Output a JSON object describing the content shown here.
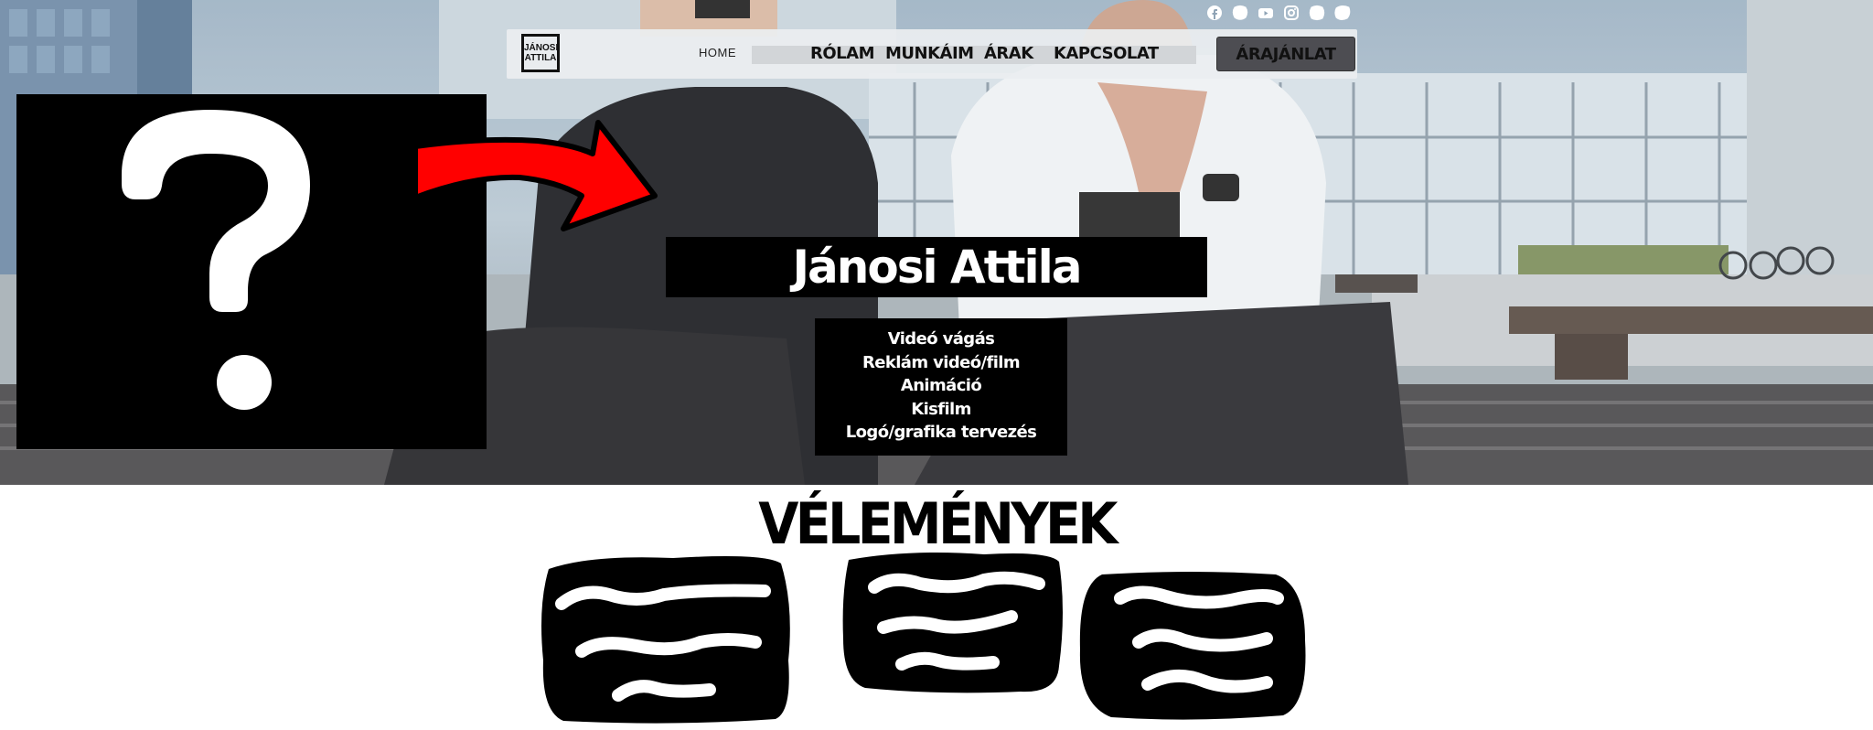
{
  "header": {
    "logo_text": [
      "JÁNOSI",
      "ATTILA"
    ],
    "nav": {
      "home": "HOME",
      "items": [
        "RÓLAM",
        "MUNKÁIM",
        "ÁRAK",
        "KAPCSOLAT"
      ],
      "cta": "ÁRAJÁNLAT"
    },
    "social_icons": [
      "facebook-icon",
      "blob-icon",
      "youtube-icon",
      "instagram-icon",
      "blob-icon",
      "blob-icon"
    ]
  },
  "hero": {
    "name": "Jánosi Attila",
    "services": [
      "Videó vágás",
      "Reklám videó/film",
      "Animáció",
      "Kisfilm",
      "Logó/grafika tervezés"
    ],
    "placeholder_icon": "question-mark-icon",
    "arrow_icon": "red-arrow-icon"
  },
  "reviews": {
    "title": "VÉLEMÉNYEK",
    "cards": [
      "review-card-1",
      "review-card-2",
      "review-card-3"
    ]
  },
  "colors": {
    "accent_red": "#ff0000",
    "black": "#000000",
    "nav_bg": "#ebeef0",
    "cta_bg": "#4d4d52"
  }
}
